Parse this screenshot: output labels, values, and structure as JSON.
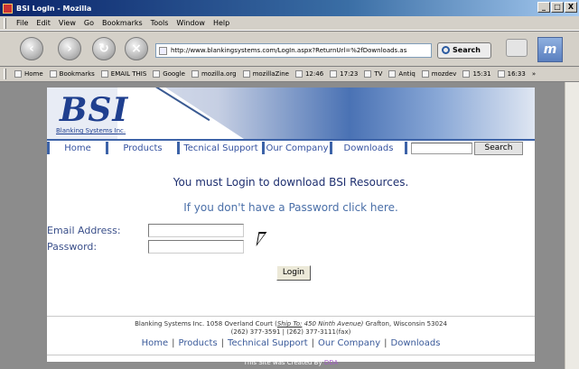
{
  "window": {
    "title": "BSI LogIn - Mozilla",
    "controls": [
      "_",
      "□",
      "X"
    ]
  },
  "menu": [
    "File",
    "Edit",
    "View",
    "Go",
    "Bookmarks",
    "Tools",
    "Window",
    "Help"
  ],
  "toolbar": {
    "url": "http://www.blankingsystems.com/LogIn.aspx?ReturnUrl=%2fDownloads.as",
    "search_label": "Search"
  },
  "bookmarks": [
    "Home",
    "Bookmarks",
    "EMAIL THIS",
    "Google",
    "mozilla.org",
    "mozillaZine",
    "12:46",
    "17:23",
    "TV",
    "Antiq",
    "mozdev",
    "15:31",
    "16:33",
    "»"
  ],
  "site": {
    "logo": "BSI",
    "company": "Blanking Systems Inc.",
    "nav": [
      "Home",
      "Products",
      "Tecnical Support",
      "Our Company",
      "Downloads"
    ],
    "nav_search_button": "Search"
  },
  "login": {
    "heading": "You must Login to download BSI Resources.",
    "subheading": "If you don't have a Password click here.",
    "email_label": "Email Address:",
    "email_value": "",
    "password_label": "Password:",
    "password_value": "",
    "button": "Login"
  },
  "footer": {
    "line1_prefix": "Blanking Systems Inc. 1058 Overland Court (",
    "ship_to": "Ship To:",
    "ship_address": " 450 Ninth Avenue)",
    "line1_suffix": " Grafton, Wisconsin 53024",
    "line2": "(262) 377-3591 | (262) 377-3111(fax)",
    "links": [
      "Home",
      "Products",
      "Technical Support",
      "Our Company",
      "Downloads"
    ]
  },
  "credit": {
    "prefix": "This Site was Created By ",
    "author": "DDA"
  }
}
